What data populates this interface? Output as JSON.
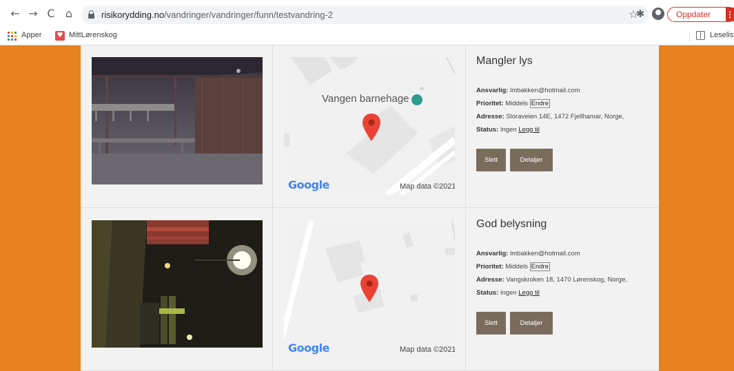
{
  "browser": {
    "url_host": "risikorydding.no",
    "url_path": "/vandringer/vandringer/funn/testvandring-2",
    "update_label": "Oppdater",
    "update_menu": "⋮",
    "back": "←",
    "forward": "→",
    "reload": "C",
    "home": "⌂",
    "star": "☆",
    "extension": "✱"
  },
  "bookmarks": {
    "apps_label": "Apper",
    "mittlorenskog_label": "MittLørenskog",
    "reading_list_label": "Leseliste"
  },
  "findings": [
    {
      "title": "Mangler lys",
      "responsible_label": "Ansvarlig:",
      "responsible": "lmbakken@hotmail.com",
      "priority_label": "Prioritet:",
      "priority": "Middels",
      "change_link": "Endre",
      "address_label": "Adresse:",
      "address": "Sloraveien 14E, 1472 Fjellhamar, Norge,",
      "status_label": "Status:",
      "status": "Ingen",
      "add_link": "Legg til",
      "delete_button": "Slett",
      "details_button": "Detaljer",
      "map": {
        "poi_label": "Vangen barnehage",
        "google": "Google",
        "attribution": "Map data ©2021"
      }
    },
    {
      "title": "God belysning",
      "responsible_label": "Ansvarlig:",
      "responsible": "lmbakken@hotmail.com",
      "priority_label": "Prioritet:",
      "priority": "Middels",
      "change_link": "Endre",
      "address_label": "Adresse:",
      "address": "Vangskroken 18, 1470 Lørenskog, Norge,",
      "status_label": "Status:",
      "status": "Ingen",
      "add_link": "Legg til",
      "delete_button": "Slett",
      "details_button": "Detaljer",
      "map": {
        "google": "Google",
        "attribution": "Map data ©2021"
      }
    }
  ],
  "colors": {
    "page_background": "#e8811f",
    "button": "#7a6c5d",
    "map_pin": "#ea4335",
    "update_red": "#d93025"
  }
}
